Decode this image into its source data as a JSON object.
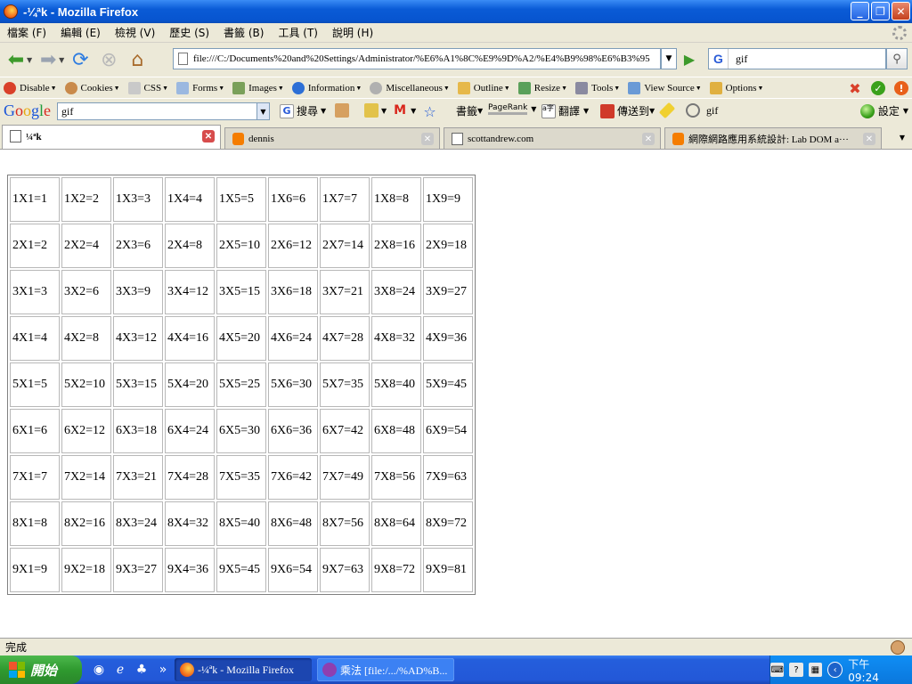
{
  "window": {
    "title": "-¼ªk - Mozilla Firefox"
  },
  "menu": [
    "檔案 (F)",
    "編輯 (E)",
    "檢視 (V)",
    "歷史 (S)",
    "書籤 (B)",
    "工具 (T)",
    "說明 (H)"
  ],
  "navigation": {
    "url": "file:///C:/Documents%20and%20Settings/Administrator/%E6%A1%8C%E9%9D%A2/%E4%B9%98%E6%B3%95",
    "search_value": "gif"
  },
  "devtoolbar": {
    "items": [
      "Disable",
      "Cookies",
      "CSS",
      "Forms",
      "Images",
      "Information",
      "Miscellaneous",
      "Outline",
      "Resize",
      "Tools",
      "View Source",
      "Options"
    ]
  },
  "googlebar": {
    "logo_letters": [
      "G",
      "o",
      "o",
      "g",
      "l",
      "e"
    ],
    "search_value": "gif",
    "search_label": "搜尋",
    "bookmarks_label": "書籤",
    "pagerank_label": "PageRank",
    "translate_label": "翻譯",
    "sendto_label": "傳送到",
    "highlight_term": "gif",
    "settings_label": "設定"
  },
  "tabs": [
    {
      "label": "¼ªk",
      "active": true,
      "icon": "page-icon"
    },
    {
      "label": "dennis",
      "active": false,
      "icon": "blogger-icon"
    },
    {
      "label": "scottandrew.com",
      "active": false,
      "icon": "page-icon"
    },
    {
      "label": "網際網路應用系統設計: Lab DOM a···",
      "active": false,
      "icon": "blogger-icon"
    }
  ],
  "table": {
    "rows": [
      [
        "1X1=1",
        "1X2=2",
        "1X3=3",
        "1X4=4",
        "1X5=5",
        "1X6=6",
        "1X7=7",
        "1X8=8",
        "1X9=9"
      ],
      [
        "2X1=2",
        "2X2=4",
        "2X3=6",
        "2X4=8",
        "2X5=10",
        "2X6=12",
        "2X7=14",
        "2X8=16",
        "2X9=18"
      ],
      [
        "3X1=3",
        "3X2=6",
        "3X3=9",
        "3X4=12",
        "3X5=15",
        "3X6=18",
        "3X7=21",
        "3X8=24",
        "3X9=27"
      ],
      [
        "4X1=4",
        "4X2=8",
        "4X3=12",
        "4X4=16",
        "4X5=20",
        "4X6=24",
        "4X7=28",
        "4X8=32",
        "4X9=36"
      ],
      [
        "5X1=5",
        "5X2=10",
        "5X3=15",
        "5X4=20",
        "5X5=25",
        "5X6=30",
        "5X7=35",
        "5X8=40",
        "5X9=45"
      ],
      [
        "6X1=6",
        "6X2=12",
        "6X3=18",
        "6X4=24",
        "6X5=30",
        "6X6=36",
        "6X7=42",
        "6X8=48",
        "6X9=54"
      ],
      [
        "7X1=7",
        "7X2=14",
        "7X3=21",
        "7X4=28",
        "7X5=35",
        "7X6=42",
        "7X7=49",
        "7X8=56",
        "7X9=63"
      ],
      [
        "8X1=8",
        "8X2=16",
        "8X3=24",
        "8X4=32",
        "8X5=40",
        "8X6=48",
        "8X7=56",
        "8X8=64",
        "8X9=72"
      ],
      [
        "9X1=9",
        "9X2=18",
        "9X3=27",
        "9X4=36",
        "9X5=45",
        "9X6=54",
        "9X7=63",
        "9X8=72",
        "9X9=81"
      ]
    ]
  },
  "status": {
    "text": "完成"
  },
  "taskbar": {
    "start_label": "開始",
    "buttons": [
      {
        "label": "-¼ªk - Mozilla Firefox",
        "active": true
      },
      {
        "label": "乘法 [file:/.../%AD%B...",
        "active": false
      }
    ],
    "clock": "下午 09:24"
  },
  "colors": {
    "titlebar": "#0755D0",
    "taskbar": "#245EDC",
    "start": "#2F9A2F",
    "active_tab_close": "#D74C4C"
  }
}
